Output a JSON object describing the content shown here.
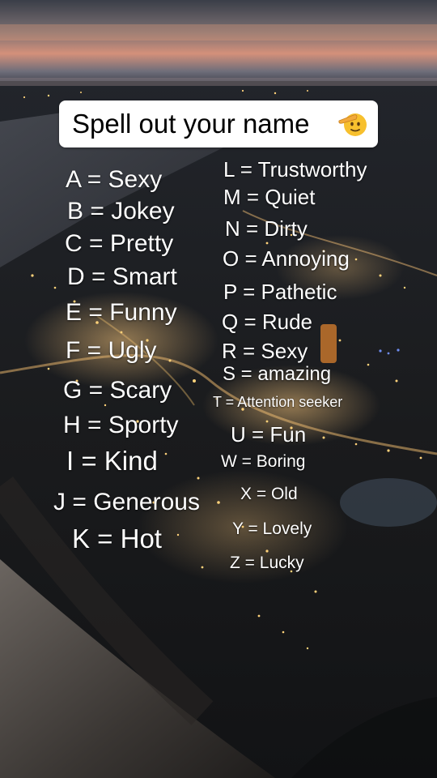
{
  "title": {
    "text": "Spell out your name",
    "emoji": "saluting-face-emoji"
  },
  "letters": [
    {
      "key": "a",
      "text": "A = Sexy"
    },
    {
      "key": "b",
      "text": "B = Jokey"
    },
    {
      "key": "c",
      "text": "C = Pretty"
    },
    {
      "key": "d",
      "text": "D = Smart"
    },
    {
      "key": "e",
      "text": "E = Funny"
    },
    {
      "key": "f",
      "text": "F = Ugly"
    },
    {
      "key": "g",
      "text": "G = Scary"
    },
    {
      "key": "h",
      "text": "H = Sporty"
    },
    {
      "key": "i",
      "text": "I = Kind"
    },
    {
      "key": "j",
      "text": "J = Generous"
    },
    {
      "key": "k",
      "text": "K = Hot"
    },
    {
      "key": "l",
      "text": "L = Trustworthy"
    },
    {
      "key": "m",
      "text": "M = Quiet"
    },
    {
      "key": "n",
      "text": "N = Dirty"
    },
    {
      "key": "o",
      "text": "O = Annoying"
    },
    {
      "key": "p",
      "text": "P = Pathetic"
    },
    {
      "key": "q",
      "text": "Q = Rude"
    },
    {
      "key": "r",
      "text": "R = Sexy"
    },
    {
      "key": "s",
      "text": "S = amazing"
    },
    {
      "key": "t",
      "text": "T = Attention seeker"
    },
    {
      "key": "u",
      "text": "U = Fun"
    },
    {
      "key": "w",
      "text": "W = Boring"
    },
    {
      "key": "x",
      "text": "X = Old"
    },
    {
      "key": "y",
      "text": "Y = Lovely"
    },
    {
      "key": "z",
      "text": "Z = Lucky"
    }
  ],
  "colors": {
    "sky_top": "#4a4e58",
    "sunset": "#d88a6a",
    "ground": "#1a1c1e",
    "city_light": "#ffd27a",
    "card": "#ffffff"
  }
}
